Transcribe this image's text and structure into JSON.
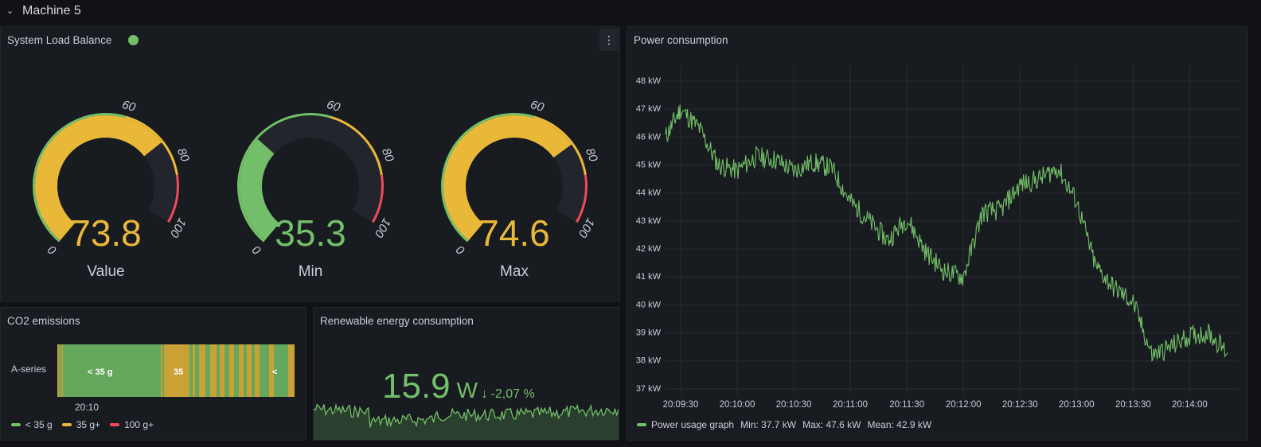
{
  "row": {
    "title": "Machine 5",
    "chevron_icon": "chevron-down-icon"
  },
  "colors": {
    "green": "#73bf69",
    "yellow": "#eab839",
    "red": "#f2495c",
    "track": "#22252b"
  },
  "load_panel": {
    "title": "System Load Balance",
    "status_color": "#73bf69",
    "menu_icon": "vertical-dots-icon",
    "gauges": [
      {
        "label": "Value",
        "value": 73.8,
        "display": "73.8",
        "color": "#eab839"
      },
      {
        "label": "Min",
        "value": 35.3,
        "display": "35.3",
        "color": "#73bf69"
      },
      {
        "label": "Max",
        "value": 74.6,
        "display": "74.6",
        "color": "#eab839"
      }
    ],
    "scale": {
      "min": 0,
      "max": 100,
      "ticks": [
        "0",
        "60",
        "80",
        "100"
      ],
      "thresholds": [
        {
          "from": 0,
          "to": 60,
          "color": "#73bf69"
        },
        {
          "from": 60,
          "to": 85,
          "color": "#eab839"
        },
        {
          "from": 85,
          "to": 100,
          "color": "#f2495c"
        }
      ]
    }
  },
  "co2_panel": {
    "title": "CO2 emissions",
    "series_label": "A-series",
    "state_labels": [
      "< 35 g",
      "35",
      "<"
    ],
    "time_label": "20:10",
    "legend": [
      {
        "label": "< 35 g",
        "color": "#73bf69"
      },
      {
        "label": "35 g+",
        "color": "#eab839"
      },
      {
        "label": "100 g+",
        "color": "#f2495c"
      }
    ]
  },
  "renew_panel": {
    "title": "Renewable energy consumption",
    "value": "15.9",
    "unit": "W",
    "change": "-2,07 %",
    "color": "#73bf69"
  },
  "power_panel": {
    "title": "Power consumption",
    "legend": {
      "series": "Power usage graph",
      "min": "Min: 37.7 kW",
      "max": "Max: 47.6 kW",
      "mean": "Mean: 42.9 kW"
    }
  },
  "chart_data": {
    "type": "line",
    "title": "Power consumption",
    "xlabel": "",
    "ylabel": "",
    "ylim": [
      37,
      48
    ],
    "y_ticks": [
      "37 kW",
      "38 kW",
      "39 kW",
      "40 kW",
      "41 kW",
      "42 kW",
      "43 kW",
      "44 kW",
      "45 kW",
      "46 kW",
      "47 kW",
      "48 kW"
    ],
    "x_ticks": [
      "20:09:30",
      "20:10:00",
      "20:10:30",
      "20:11:00",
      "20:11:30",
      "20:12:00",
      "20:12:30",
      "20:13:00",
      "20:13:30",
      "20:14:00"
    ],
    "series": [
      {
        "name": "Power usage graph",
        "color": "#73bf69",
        "x": [
          "20:09:22",
          "20:09:30",
          "20:09:40",
          "20:09:50",
          "20:10:00",
          "20:10:10",
          "20:10:20",
          "20:10:30",
          "20:10:40",
          "20:10:50",
          "20:11:00",
          "20:11:10",
          "20:11:20",
          "20:11:30",
          "20:11:40",
          "20:11:50",
          "20:12:00",
          "20:12:10",
          "20:12:20",
          "20:12:30",
          "20:12:40",
          "20:12:50",
          "20:13:00",
          "20:13:10",
          "20:13:20",
          "20:13:30",
          "20:13:40",
          "20:13:50",
          "20:14:00",
          "20:14:10",
          "20:14:20"
        ],
        "values": [
          46.0,
          47.0,
          46.3,
          45.0,
          44.8,
          45.3,
          45.2,
          44.8,
          45.1,
          44.9,
          43.7,
          43.0,
          42.3,
          43.1,
          41.9,
          41.2,
          41.0,
          43.3,
          43.4,
          44.3,
          44.5,
          44.9,
          43.7,
          41.4,
          40.6,
          40.1,
          38.2,
          38.5,
          38.9,
          39.0,
          38.3
        ]
      }
    ]
  }
}
